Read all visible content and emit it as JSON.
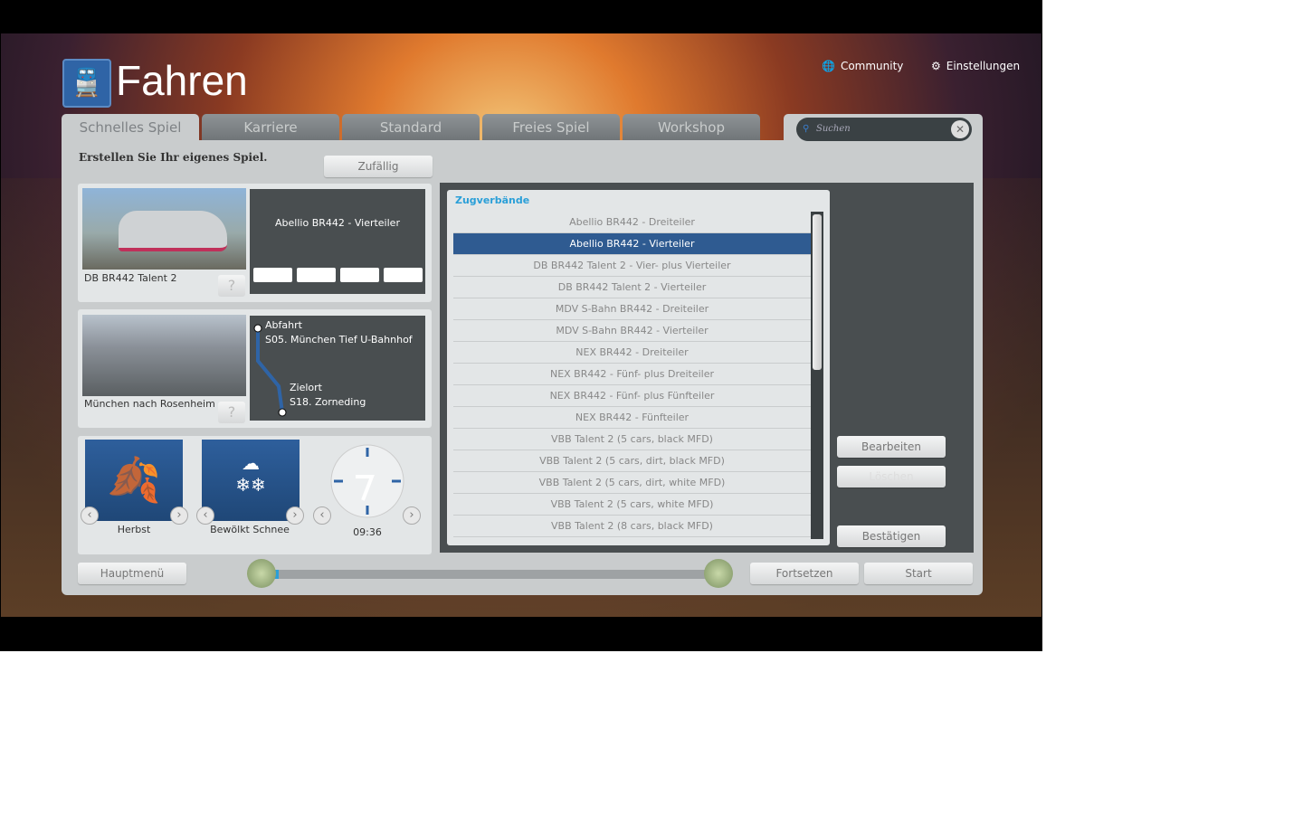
{
  "header": {
    "title": "Fahren",
    "community": "Community",
    "settings": "Einstellungen"
  },
  "tabs": [
    "Schnelles Spiel",
    "Karriere",
    "Standard",
    "Freies Spiel",
    "Workshop"
  ],
  "search": {
    "placeholder": "Suchen"
  },
  "quick": {
    "heading": "Erstellen Sie Ihr eigenes Spiel.",
    "random": "Zufällig",
    "help": "?"
  },
  "train": {
    "name": "DB BR442 Talent 2",
    "formation": "Abellio BR442 - Vierteiler"
  },
  "route": {
    "name": "München nach Rosenheim",
    "start_label": "Abfahrt",
    "start": "S05. München Tief U-Bahnhof",
    "end_label": "Zielort",
    "end": "S18. Zorneding"
  },
  "conditions": {
    "season": "Herbst",
    "weather": "Bewölkt Schnee",
    "time": "09:36"
  },
  "formations": {
    "title": "Zugverbände",
    "selected_index": 1,
    "items": [
      "Abellio BR442 - Dreiteiler",
      "Abellio BR442 - Vierteiler",
      "DB BR442 Talent 2 - Vier- plus Vierteiler",
      "DB BR442 Talent 2 - Vierteiler",
      "MDV S-Bahn BR442 - Dreiteiler",
      "MDV S-Bahn BR442 - Vierteiler",
      "NEX BR442 - Dreiteiler",
      "NEX BR442 - Fünf- plus Dreiteiler",
      "NEX BR442 - Fünf- plus Fünfteiler",
      "NEX BR442 - Fünfteiler",
      "VBB Talent 2 (5 cars, black MFD)",
      "VBB Talent 2 (5 cars, dirt, black MFD)",
      "VBB Talent 2 (5 cars, dirt, white MFD)",
      "VBB Talent 2 (5 cars, white MFD)",
      "VBB Talent 2 (8 cars, black MFD)"
    ]
  },
  "actions": {
    "edit": "Bearbeiten",
    "delete": "Löschen",
    "confirm": "Bestätigen"
  },
  "footer": {
    "main_menu": "Hauptmenü",
    "continue": "Fortsetzen",
    "start": "Start",
    "progress_percent": 4
  },
  "colors": {
    "accent": "#2f5b91",
    "title_blue": "#2a9fd8"
  }
}
